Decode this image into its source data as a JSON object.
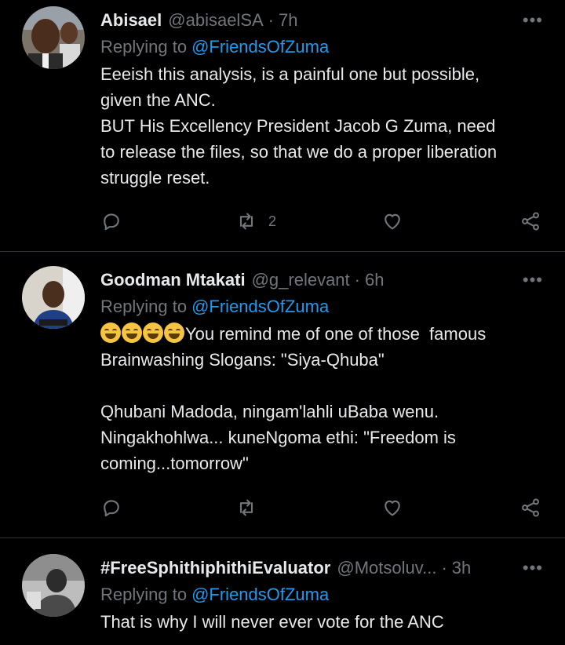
{
  "tweets": [
    {
      "name": "Abisael",
      "handle": "@abisaelSA",
      "time": "7h",
      "replying_prefix": "Replying to",
      "replying_to": "@FriendsOfZuma",
      "text": "Eeeish this analysis, is a painful one but possible,\ngiven the ANC.\nBUT His Excellency President Jacob G Zuma, need\nto release the files, so that we do a proper liberation\nstruggle reset.",
      "retweets": "2"
    },
    {
      "name": "Goodman Mtakati",
      "handle": "@g_relevant",
      "time": "6h",
      "replying_prefix": "Replying to",
      "replying_to": "@FriendsOfZuma",
      "text_line1": "You remind me of one of those  famous",
      "text_rest": "Brainwashing Slogans: \"Siya-Qhuba\"\n\nQhubani Madoda, ningam'lahli uBaba wenu.\nNingakhohlwa... kuneNgoma ethi: \"Freedom is\ncoming...tomorrow\"",
      "avatar_caption": "Goodman Mtakati"
    },
    {
      "name": "#FreeSphithiphithiEvaluator",
      "handle": "@Motsoluv...",
      "time": "3h",
      "replying_prefix": "Replying to",
      "replying_to": "@FriendsOfZuma",
      "text": "That is why I will never ever vote for the ANC"
    }
  ],
  "icons": {
    "more": "more-icon",
    "reply": "reply-icon",
    "retweet": "retweet-icon",
    "like": "heart-icon",
    "share": "share-icon"
  },
  "colors": {
    "background": "#000000",
    "text": "#e7e9ea",
    "muted": "#71767b",
    "link": "#1d9bf0",
    "divider": "#2f3336"
  }
}
